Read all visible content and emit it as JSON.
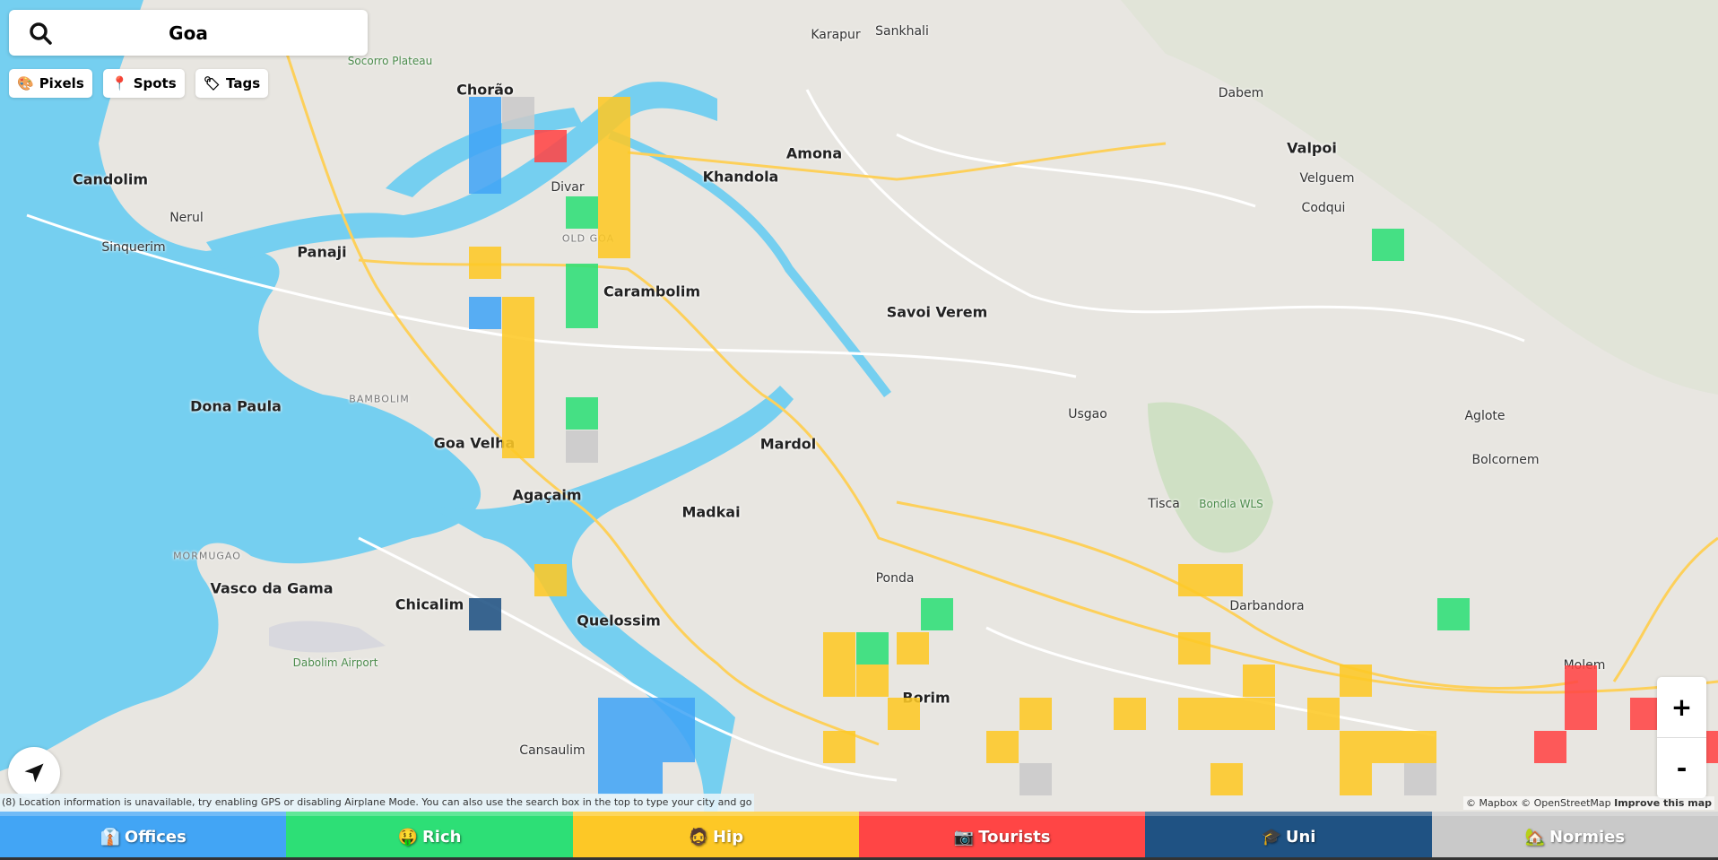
{
  "search": {
    "value": "Goa",
    "icon": "search-icon"
  },
  "modes": [
    {
      "label": "Pixels",
      "icon": "palette-icon"
    },
    {
      "label": "Spots",
      "icon": "pin-icon"
    },
    {
      "label": "Tags",
      "icon": "tag-icon"
    }
  ],
  "map": {
    "places": [
      {
        "name": "Chorão",
        "style": "big"
      },
      {
        "name": "Candolim",
        "style": "big"
      },
      {
        "name": "Nerul",
        "style": ""
      },
      {
        "name": "Sinquerim",
        "style": ""
      },
      {
        "name": "Panaji",
        "style": "big"
      },
      {
        "name": "Socorro Plateau",
        "style": "park"
      },
      {
        "name": "Karapur",
        "style": ""
      },
      {
        "name": "Sankhali",
        "style": ""
      },
      {
        "name": "Dabem",
        "style": ""
      },
      {
        "name": "Valpoi",
        "style": "big"
      },
      {
        "name": "Velguem",
        "style": ""
      },
      {
        "name": "Codqui",
        "style": ""
      },
      {
        "name": "Amona",
        "style": "big"
      },
      {
        "name": "Khandola",
        "style": "big"
      },
      {
        "name": "Divar",
        "style": ""
      },
      {
        "name": "OLD GOA",
        "style": "caps"
      },
      {
        "name": "Carambolim",
        "style": "big"
      },
      {
        "name": "Savoi Verem",
        "style": "big"
      },
      {
        "name": "Usgao",
        "style": ""
      },
      {
        "name": "Aglote",
        "style": ""
      },
      {
        "name": "Bolcornem",
        "style": ""
      },
      {
        "name": "Tisca",
        "style": ""
      },
      {
        "name": "Bondla WLS",
        "style": "park"
      },
      {
        "name": "Dona Paula",
        "style": "big"
      },
      {
        "name": "BAMBOLIM",
        "style": "caps"
      },
      {
        "name": "Goa Velha",
        "style": "big"
      },
      {
        "name": "Mardol",
        "style": "big"
      },
      {
        "name": "Agaçaim",
        "style": "big"
      },
      {
        "name": "Madkai",
        "style": "big"
      },
      {
        "name": "MORMUGAO",
        "style": "caps"
      },
      {
        "name": "Vasco da Gama",
        "style": "big"
      },
      {
        "name": "Chicalim",
        "style": "big"
      },
      {
        "name": "Quelossim",
        "style": "big"
      },
      {
        "name": "Ponda",
        "style": ""
      },
      {
        "name": "Darbandora",
        "style": ""
      },
      {
        "name": "Borim",
        "style": "big"
      },
      {
        "name": "Molem",
        "style": ""
      },
      {
        "name": "Cansaulim",
        "style": ""
      },
      {
        "name": "Dabolim Airport",
        "style": "park"
      }
    ]
  },
  "location_button": {
    "icon": "navigation-arrow-icon"
  },
  "message": "(8) Location information is unavailable, try enabling GPS or disabling Airplane Mode. You can also use the search box in the top to type your city and go there.",
  "zoom": {
    "in": "+",
    "out": "-"
  },
  "attribution": {
    "mapbox": "© Mapbox",
    "osm": "© OpenStreetMap",
    "improve": "Improve this map"
  },
  "categories": [
    {
      "label": "Offices",
      "emoji": "👔",
      "color": "#42a5f5"
    },
    {
      "label": "Rich",
      "emoji": "🤑",
      "color": "#2ddf76"
    },
    {
      "label": "Hip",
      "emoji": "🧔",
      "color": "#fdc826"
    },
    {
      "label": "Tourists",
      "emoji": "📷",
      "color": "#ff4545"
    },
    {
      "label": "Uni",
      "emoji": "🎓",
      "color": "#1f5283"
    },
    {
      "label": "Normies",
      "emoji": "🏡",
      "color": "#c9c9c9"
    }
  ]
}
